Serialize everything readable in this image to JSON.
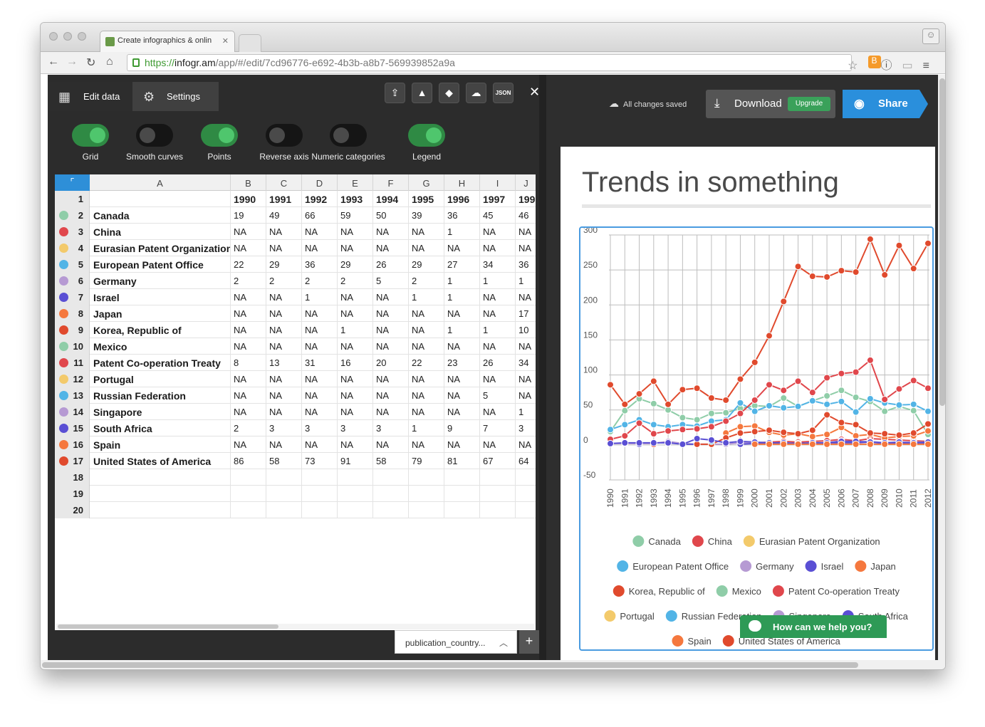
{
  "browser": {
    "tab_title": "Create infographics & onlin",
    "url_scheme": "https://",
    "url_host": "infogr.am",
    "url_path": "/app/#/edit/7cd96776-e692-4b3b-a8b7-569939852a9a"
  },
  "editor": {
    "tabs": {
      "edit": "Edit data",
      "settings": "Settings"
    },
    "json_button": "JSON",
    "toggles": [
      {
        "label": "Grid",
        "on": true
      },
      {
        "label": "Smooth curves",
        "on": false
      },
      {
        "label": "Points",
        "on": true
      },
      {
        "label": "Reverse axis",
        "on": false
      },
      {
        "label": "Numeric categories",
        "on": false
      },
      {
        "label": "Legend",
        "on": true
      }
    ],
    "columns": [
      "A",
      "B",
      "C",
      "D",
      "E",
      "F",
      "G",
      "H",
      "I",
      "J"
    ],
    "row_numbers": [
      "1",
      "2",
      "3",
      "4",
      "5",
      "6",
      "7",
      "8",
      "9",
      "10",
      "11",
      "12",
      "13",
      "14",
      "15",
      "16",
      "17",
      "18",
      "19",
      "20"
    ],
    "header_row": [
      "1990",
      "1991",
      "1992",
      "1993",
      "1994",
      "1995",
      "1996",
      "1997",
      "199"
    ],
    "rows": [
      {
        "name": "Canada",
        "color": "#8fcda8",
        "cells": [
          "19",
          "49",
          "66",
          "59",
          "50",
          "39",
          "36",
          "45",
          "46"
        ]
      },
      {
        "name": "China",
        "color": "#e0474c",
        "cells": [
          "NA",
          "NA",
          "NA",
          "NA",
          "NA",
          "NA",
          "1",
          "NA",
          "NA"
        ]
      },
      {
        "name": "Eurasian Patent Organization",
        "color": "#f3ca6b",
        "cells": [
          "NA",
          "NA",
          "NA",
          "NA",
          "NA",
          "NA",
          "NA",
          "NA",
          "NA"
        ]
      },
      {
        "name": "European Patent Office",
        "color": "#52b4e6",
        "cells": [
          "22",
          "29",
          "36",
          "29",
          "26",
          "29",
          "27",
          "34",
          "36"
        ]
      },
      {
        "name": "Germany",
        "color": "#b69ad3",
        "cells": [
          "2",
          "2",
          "2",
          "2",
          "5",
          "2",
          "1",
          "1",
          "1"
        ]
      },
      {
        "name": "Israel",
        "color": "#5a4fd4",
        "cells": [
          "NA",
          "NA",
          "1",
          "NA",
          "NA",
          "1",
          "1",
          "NA",
          "NA"
        ]
      },
      {
        "name": "Japan",
        "color": "#f5783e",
        "cells": [
          "NA",
          "NA",
          "NA",
          "NA",
          "NA",
          "NA",
          "NA",
          "NA",
          "17"
        ]
      },
      {
        "name": "Korea, Republic of",
        "color": "#e04a2d",
        "cells": [
          "NA",
          "NA",
          "NA",
          "1",
          "NA",
          "NA",
          "1",
          "1",
          "10"
        ]
      },
      {
        "name": "Mexico",
        "color": "#8fcda8",
        "cells": [
          "NA",
          "NA",
          "NA",
          "NA",
          "NA",
          "NA",
          "NA",
          "NA",
          "NA"
        ]
      },
      {
        "name": "Patent Co-operation Treaty",
        "color": "#e0474c",
        "cells": [
          "8",
          "13",
          "31",
          "16",
          "20",
          "22",
          "23",
          "26",
          "34"
        ]
      },
      {
        "name": "Portugal",
        "color": "#f3ca6b",
        "cells": [
          "NA",
          "NA",
          "NA",
          "NA",
          "NA",
          "NA",
          "NA",
          "NA",
          "NA"
        ]
      },
      {
        "name": "Russian Federation",
        "color": "#52b4e6",
        "cells": [
          "NA",
          "NA",
          "NA",
          "NA",
          "NA",
          "NA",
          "NA",
          "5",
          "NA"
        ]
      },
      {
        "name": "Singapore",
        "color": "#b69ad3",
        "cells": [
          "NA",
          "NA",
          "NA",
          "NA",
          "NA",
          "NA",
          "NA",
          "NA",
          "1"
        ]
      },
      {
        "name": "South Africa",
        "color": "#5a4fd4",
        "cells": [
          "2",
          "3",
          "3",
          "3",
          "3",
          "1",
          "9",
          "7",
          "3"
        ]
      },
      {
        "name": "Spain",
        "color": "#f5783e",
        "cells": [
          "NA",
          "NA",
          "NA",
          "NA",
          "NA",
          "NA",
          "NA",
          "NA",
          "NA"
        ]
      },
      {
        "name": "United States of America",
        "color": "#e04a2d",
        "cells": [
          "86",
          "58",
          "73",
          "91",
          "58",
          "79",
          "81",
          "67",
          "64"
        ]
      }
    ],
    "sheet_name": "publication_country...",
    "add_sheet": "+"
  },
  "preview": {
    "saved_status": "All changes saved",
    "download_label": "Download",
    "upgrade_label": "Upgrade",
    "share_label": "Share",
    "chart_title": "Trends in something",
    "chat_label": "How can we help you?"
  },
  "chart_data": {
    "type": "line",
    "title": "Trends in something",
    "ylim": [
      -50,
      300
    ],
    "yticks": [
      "300",
      "250",
      "200",
      "150",
      "100",
      "50",
      "0",
      "-50"
    ],
    "grid": true,
    "legend": "bottom",
    "x": [
      "1990",
      "1991",
      "1992",
      "1993",
      "1994",
      "1995",
      "1996",
      "1997",
      "1998",
      "1999",
      "2000",
      "2001",
      "2002",
      "2003",
      "2004",
      "2005",
      "2006",
      "2007",
      "2008",
      "2009",
      "2010",
      "2011",
      "2012"
    ],
    "series": [
      {
        "name": "Canada",
        "color": "#8fcda8",
        "values": [
          19,
          49,
          66,
          59,
          50,
          39,
          36,
          45,
          46,
          52,
          56,
          55,
          67,
          55,
          63,
          70,
          78,
          68,
          62,
          48,
          55,
          49,
          15
        ]
      },
      {
        "name": "China",
        "color": "#e0474c",
        "values": [
          null,
          null,
          null,
          null,
          null,
          null,
          1,
          null,
          null,
          2,
          3,
          4,
          5,
          4,
          5,
          6,
          8,
          6,
          9,
          8,
          7,
          6,
          5
        ]
      },
      {
        "name": "Eurasian Patent Organization",
        "color": "#f3ca6b",
        "values": [
          null,
          null,
          null,
          null,
          null,
          null,
          null,
          null,
          null,
          null,
          null,
          null,
          null,
          null,
          null,
          null,
          null,
          null,
          null,
          null,
          null,
          null,
          null
        ]
      },
      {
        "name": "European Patent Office",
        "color": "#52b4e6",
        "values": [
          22,
          29,
          36,
          29,
          26,
          29,
          27,
          34,
          36,
          60,
          48,
          56,
          53,
          55,
          63,
          58,
          62,
          47,
          66,
          60,
          57,
          58,
          48
        ]
      },
      {
        "name": "Germany",
        "color": "#b69ad3",
        "values": [
          2,
          2,
          2,
          2,
          5,
          2,
          1,
          1,
          1,
          3,
          3,
          2,
          3,
          2,
          3,
          3,
          6,
          4,
          5,
          3,
          3,
          4,
          4
        ]
      },
      {
        "name": "Israel",
        "color": "#5a4fd4",
        "values": [
          null,
          null,
          1,
          null,
          null,
          1,
          1,
          null,
          null,
          1,
          2,
          2,
          2,
          2,
          2,
          3,
          3,
          3,
          4,
          2,
          2,
          3,
          2
        ]
      },
      {
        "name": "Japan",
        "color": "#f5783e",
        "values": [
          null,
          null,
          null,
          null,
          null,
          null,
          null,
          null,
          17,
          26,
          27,
          18,
          14,
          16,
          12,
          15,
          25,
          13,
          15,
          10,
          12,
          13,
          20
        ]
      },
      {
        "name": "Korea, Republic of",
        "color": "#e04a2d",
        "values": [
          null,
          null,
          null,
          1,
          null,
          null,
          1,
          1,
          10,
          17,
          19,
          21,
          18,
          16,
          21,
          43,
          32,
          29,
          17,
          16,
          14,
          17,
          30
        ]
      },
      {
        "name": "Mexico",
        "color": "#8fcda8",
        "values": [
          null,
          null,
          null,
          null,
          null,
          null,
          null,
          null,
          null,
          null,
          null,
          null,
          null,
          null,
          null,
          null,
          null,
          null,
          null,
          null,
          null,
          null,
          null
        ]
      },
      {
        "name": "Patent Co-operation Treaty",
        "color": "#e0474c",
        "values": [
          8,
          13,
          31,
          16,
          20,
          22,
          23,
          26,
          34,
          45,
          64,
          86,
          78,
          91,
          75,
          96,
          102,
          104,
          121,
          65,
          80,
          92,
          81
        ]
      },
      {
        "name": "Portugal",
        "color": "#f3ca6b",
        "values": [
          null,
          null,
          null,
          null,
          null,
          null,
          null,
          null,
          null,
          null,
          null,
          null,
          null,
          null,
          null,
          null,
          null,
          null,
          null,
          null,
          null,
          null,
          null
        ]
      },
      {
        "name": "Russian Federation",
        "color": "#52b4e6",
        "values": [
          null,
          null,
          null,
          null,
          null,
          null,
          null,
          5,
          null,
          null,
          null,
          null,
          null,
          null,
          null,
          null,
          null,
          null,
          null,
          null,
          null,
          null,
          null
        ]
      },
      {
        "name": "Singapore",
        "color": "#b69ad3",
        "values": [
          null,
          null,
          null,
          null,
          null,
          null,
          null,
          null,
          1,
          null,
          null,
          null,
          null,
          null,
          null,
          null,
          null,
          null,
          null,
          null,
          null,
          null,
          null
        ]
      },
      {
        "name": "South Africa",
        "color": "#5a4fd4",
        "values": [
          2,
          3,
          3,
          3,
          3,
          1,
          9,
          7,
          3,
          5,
          4,
          3,
          3,
          2,
          3,
          3,
          5,
          5,
          4,
          3,
          4,
          3,
          4
        ]
      },
      {
        "name": "Spain",
        "color": "#f5783e",
        "values": [
          null,
          null,
          null,
          null,
          null,
          null,
          null,
          null,
          null,
          null,
          1,
          1,
          1,
          1,
          1,
          1,
          1,
          1,
          1,
          1,
          1,
          1,
          1
        ]
      },
      {
        "name": "United States of America",
        "color": "#e04a2d",
        "values": [
          86,
          58,
          73,
          91,
          58,
          79,
          81,
          67,
          64,
          94,
          118,
          156,
          205,
          255,
          241,
          240,
          249,
          247,
          294,
          243,
          285,
          252,
          288
        ]
      }
    ]
  }
}
